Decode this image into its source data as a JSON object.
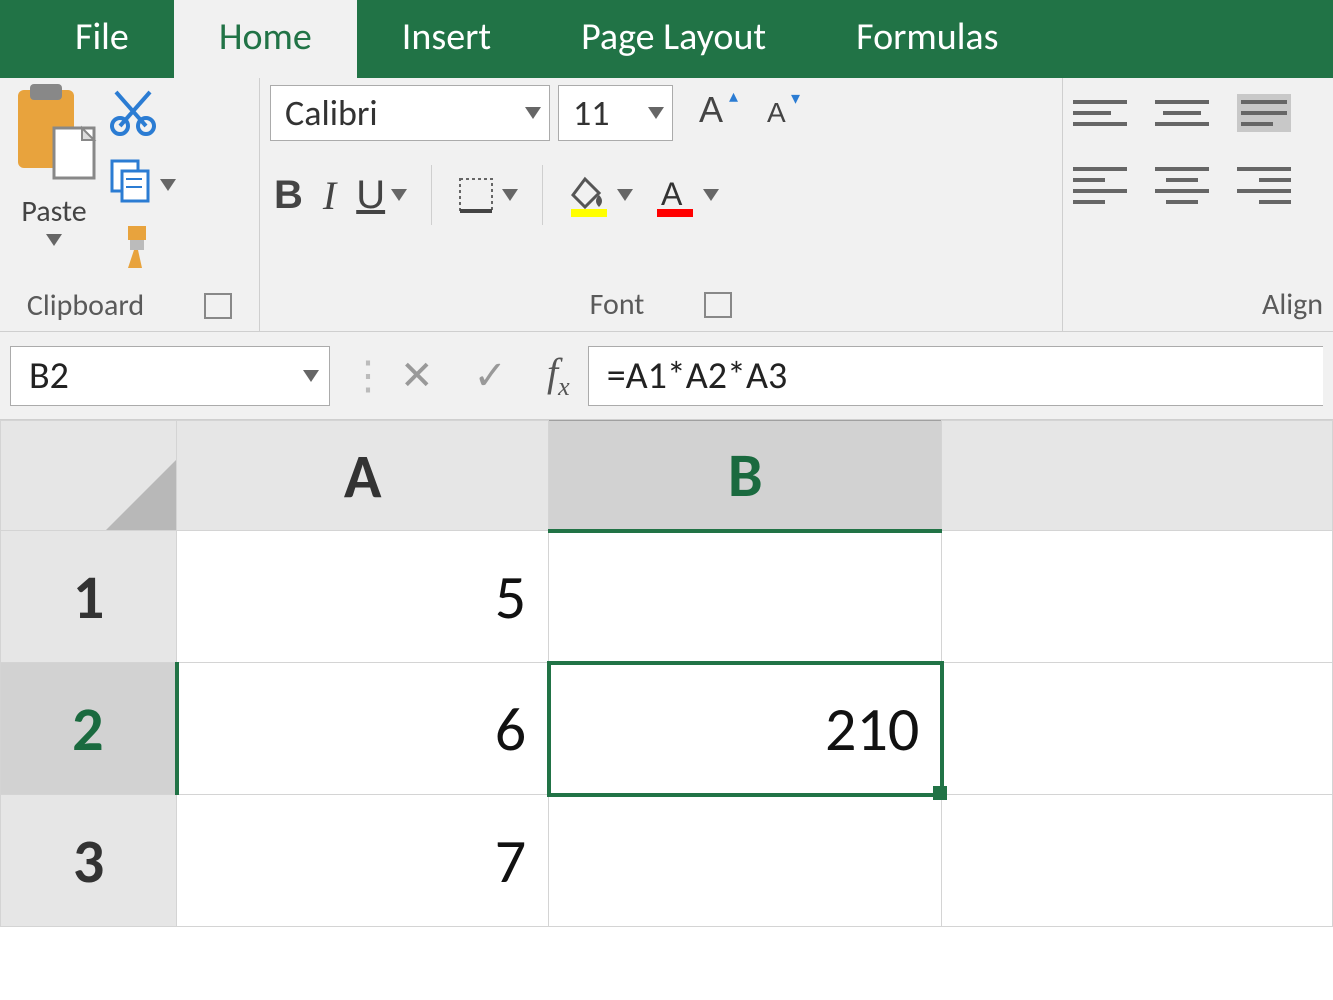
{
  "ribbon": {
    "tabs": [
      "File",
      "Home",
      "Insert",
      "Page Layout",
      "Formulas"
    ],
    "active_tab": "Home",
    "clipboard": {
      "paste_label": "Paste",
      "group_label": "Clipboard"
    },
    "font": {
      "name": "Calibri",
      "size": "11",
      "group_label": "Font"
    },
    "alignment": {
      "group_label": "Align"
    }
  },
  "formula_bar": {
    "name_box": "B2",
    "formula": "=A1*A2*A3"
  },
  "sheet": {
    "columns": [
      "A",
      "B"
    ],
    "rows": [
      {
        "n": "1",
        "A": "5",
        "B": ""
      },
      {
        "n": "2",
        "A": "6",
        "B": "210"
      },
      {
        "n": "3",
        "A": "7",
        "B": ""
      }
    ],
    "selected_cell": "B2"
  }
}
